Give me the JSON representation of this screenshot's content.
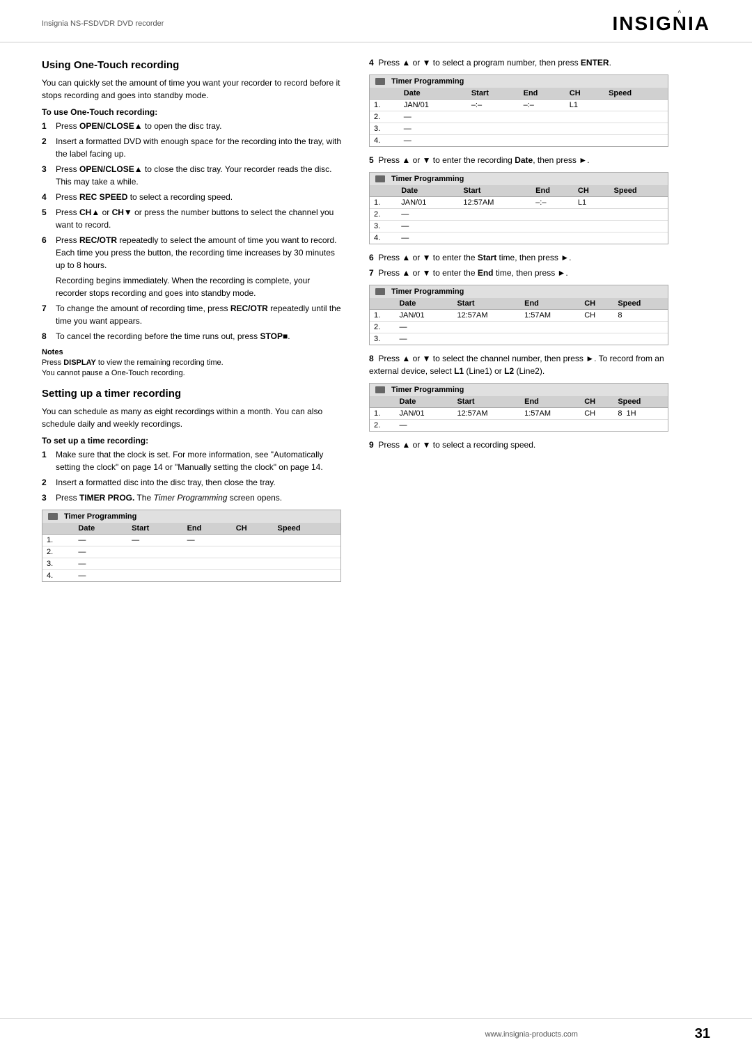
{
  "header": {
    "model": "Insignia NS-FSDVDR DVD recorder",
    "logo": "INSIĜNIA"
  },
  "footer": {
    "url": "www.insignia-products.com",
    "page_number": "31"
  },
  "left_col": {
    "section1_title": "Using One-Touch recording",
    "section1_intro": "You can quickly set the amount of time you want your recorder to record before it stops recording and goes into standby mode.",
    "section1_subheading": "To use One-Touch recording:",
    "section1_steps": [
      {
        "num": "1",
        "text": "Press OPEN/CLOSE▲ to open the disc tray."
      },
      {
        "num": "2",
        "text": "Insert a formatted DVD with enough space for the recording into the tray, with the label facing up."
      },
      {
        "num": "3",
        "text": "Press OPEN/CLOSE▲ to close the disc tray. Your recorder reads the disc. This may take a while."
      },
      {
        "num": "4",
        "text": "Press REC SPEED to select a recording speed."
      },
      {
        "num": "5",
        "text": "Press CH▲ or CH▼ or press the number buttons to select the channel you want to record."
      },
      {
        "num": "6",
        "text": "Press REC/OTR repeatedly to select the amount of time you want to record. Each time you press the button, the recording time increases by 30 minutes up to 8 hours."
      },
      {
        "num": "",
        "text": "Recording begins immediately. When the recording is complete, your recorder stops recording and goes into standby mode."
      },
      {
        "num": "7",
        "text": "To change the amount of recording time, press REC/OTR repeatedly until the time you want appears."
      },
      {
        "num": "8",
        "text": "To cancel the recording before the time runs out, press STOP■."
      }
    ],
    "notes_title": "Notes",
    "notes_lines": [
      "Press DISPLAY to view the remaining recording time.",
      "You cannot pause a One-Touch recording."
    ],
    "section2_title": "Setting up a timer recording",
    "section2_intro": "You can schedule as many as eight recordings within a month. You can also schedule daily and weekly recordings.",
    "section2_subheading": "To set up a time recording:",
    "section2_steps": [
      {
        "num": "1",
        "text": "Make sure that the clock is set. For more information, see \"Automatically setting the clock\" on page 14 or \"Manually setting the clock\" on page 14."
      },
      {
        "num": "2",
        "text": "Insert a formatted disc into the disc tray, then close the tray."
      },
      {
        "num": "3",
        "text": "Press TIMER PROG. The Timer Programming screen opens."
      }
    ],
    "table1": {
      "title": "Timer Programming",
      "columns": [
        "Date",
        "Start",
        "End",
        "CH",
        "Speed"
      ],
      "rows": [
        {
          "num": "1.",
          "date": "—",
          "start": "—",
          "end": "—",
          "ch": "",
          "speed": ""
        },
        {
          "num": "2.",
          "date": "—",
          "start": "",
          "end": "",
          "ch": "",
          "speed": ""
        },
        {
          "num": "3.",
          "date": "—",
          "start": "",
          "end": "",
          "ch": "",
          "speed": ""
        },
        {
          "num": "4.",
          "date": "—",
          "start": "",
          "end": "",
          "ch": "",
          "speed": ""
        }
      ]
    }
  },
  "right_col": {
    "step4_text": "Press ▲ or ▼ to select a program number, then press ENTER.",
    "table2": {
      "title": "Timer Programming",
      "columns": [
        "Date",
        "Start",
        "End",
        "CH",
        "Speed"
      ],
      "rows": [
        {
          "num": "1.",
          "date": "JAN/01",
          "start": "–:–",
          "end": "–:–",
          "ch": "L1",
          "speed": ""
        },
        {
          "num": "2.",
          "date": "—",
          "start": "",
          "end": "",
          "ch": "",
          "speed": ""
        },
        {
          "num": "3.",
          "date": "—",
          "start": "",
          "end": "",
          "ch": "",
          "speed": ""
        },
        {
          "num": "4.",
          "date": "—",
          "start": "",
          "end": "",
          "ch": "",
          "speed": ""
        }
      ]
    },
    "step5_text": "Press ▲ or ▼ to enter the recording Date, then press ►.",
    "table3": {
      "title": "Timer Programming",
      "columns": [
        "Date",
        "Start",
        "End",
        "CH",
        "Speed"
      ],
      "rows": [
        {
          "num": "1.",
          "date": "JAN/01",
          "start": "12:57AM",
          "end": "–:–",
          "ch": "L1",
          "speed": ""
        },
        {
          "num": "2.",
          "date": "—",
          "start": "",
          "end": "",
          "ch": "",
          "speed": ""
        },
        {
          "num": "3.",
          "date": "—",
          "start": "",
          "end": "",
          "ch": "",
          "speed": ""
        },
        {
          "num": "4.",
          "date": "—",
          "start": "",
          "end": "",
          "ch": "",
          "speed": ""
        }
      ]
    },
    "step6_text": "Press ▲ or ▼ to enter the Start time, then press ►.",
    "step7_text": "Press ▲ or ▼ to enter the End time, then press ►.",
    "table4": {
      "title": "Timer Programming",
      "columns": [
        "Date",
        "Start",
        "End",
        "CH",
        "Speed"
      ],
      "rows": [
        {
          "num": "1.",
          "date": "JAN/01",
          "start": "12:57AM",
          "end": "1:57AM",
          "ch": "CH",
          "speed": "8"
        },
        {
          "num": "2.",
          "date": "—",
          "start": "",
          "end": "",
          "ch": "",
          "speed": ""
        },
        {
          "num": "3.",
          "date": "—",
          "start": "",
          "end": "",
          "ch": "",
          "speed": ""
        }
      ]
    },
    "step8_text": "Press ▲ or ▼ to select the channel number, then press ►. To record from an external device, select L1 (Line1) or L2 (Line2).",
    "table5": {
      "title": "Timer Programming",
      "columns": [
        "Date",
        "Start",
        "End",
        "CH",
        "Speed"
      ],
      "rows": [
        {
          "num": "1.",
          "date": "JAN/01",
          "start": "12:57AM",
          "end": "1:57AM",
          "ch": "CH",
          "speed": "8  1H"
        },
        {
          "num": "2.",
          "date": "—",
          "start": "",
          "end": "",
          "ch": "",
          "speed": ""
        }
      ]
    },
    "step9_text": "Press ▲ or ▼ to select a recording speed."
  }
}
